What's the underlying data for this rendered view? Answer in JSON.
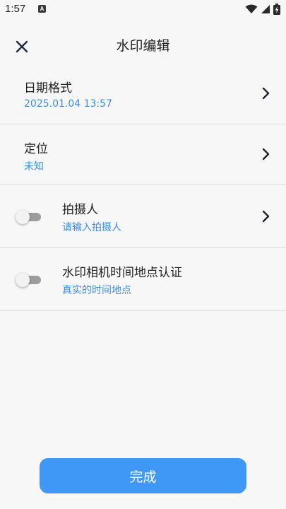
{
  "status_bar": {
    "time": "1:57",
    "notification_icon_letter": "A"
  },
  "header": {
    "title": "水印编辑"
  },
  "rows": [
    {
      "title": "日期格式",
      "subtitle": "2025.01.04 13:57",
      "has_toggle": false,
      "has_chevron": true
    },
    {
      "title": "定位",
      "subtitle": "未知",
      "has_toggle": false,
      "has_chevron": true
    },
    {
      "title": "拍摄人",
      "subtitle": "请输入拍摄人",
      "has_toggle": true,
      "toggle_on": false,
      "has_chevron": true
    },
    {
      "title": "水印相机时间地点认证",
      "subtitle": "真实的时间地点",
      "has_toggle": true,
      "toggle_on": false,
      "has_chevron": false
    }
  ],
  "footer": {
    "done_label": "完成"
  },
  "colors": {
    "accent": "#3f97f6",
    "subtitle": "#3b8ef0",
    "background": "#f7f7f7"
  }
}
